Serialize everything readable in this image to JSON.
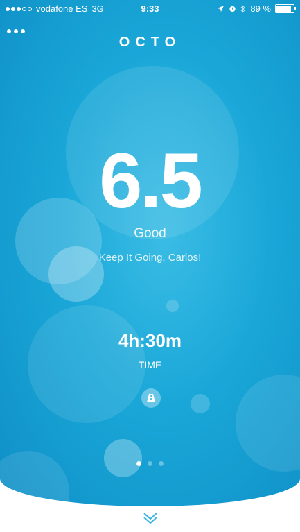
{
  "status_bar": {
    "carrier": "vodafone ES",
    "network": "3G",
    "time": "9:33",
    "battery_percent": "89 %",
    "battery_level": 0.89
  },
  "header": {
    "logo": "OCTO"
  },
  "score": {
    "value": "6.5",
    "rating": "Good",
    "message": "Keep It Going, Carlos!"
  },
  "trip": {
    "duration": "4h:30m",
    "label": "TIME",
    "icon": "road-icon"
  },
  "pager": {
    "pages": 3,
    "active_index": 0
  },
  "footer": {
    "icon": "chevron-down-icon"
  },
  "colors": {
    "primary": "#1aa7d8",
    "text": "#ffffff"
  }
}
